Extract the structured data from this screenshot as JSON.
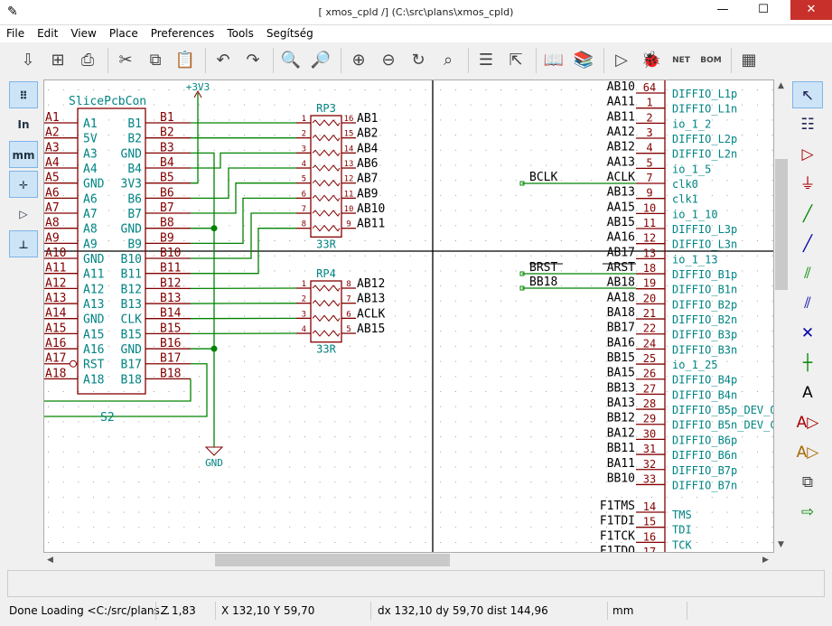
{
  "window": {
    "title": "[ xmos_cpld /] (C:\\src\\plans\\xmos_cpld)",
    "minimize": "—",
    "maximize": "☐",
    "close": "✕"
  },
  "menu": [
    "File",
    "Edit",
    "View",
    "Place",
    "Preferences",
    "Tools",
    "Segítség"
  ],
  "toolbar": [
    "save-icon",
    "page-settings-icon",
    "print-icon",
    "cut-icon",
    "copy-icon",
    "paste-icon",
    "undo-icon",
    "redo-icon",
    "find-icon",
    "find-replace-icon",
    "zoom-in-icon",
    "zoom-out-icon",
    "redraw-icon",
    "zoom-fit-icon",
    "hierarchy-icon",
    "leave-sheet-icon",
    "library-editor-icon",
    "library-browser-icon",
    "annotate-icon",
    "erc-icon",
    "netlist-icon",
    "bom-icon",
    "pcbnew-icon"
  ],
  "toolbar_glyphs": [
    "⇩",
    "⊞",
    "⎙",
    "✂",
    "⧉",
    "📋",
    "↶",
    "↷",
    "🔍",
    "🔎",
    "⊕",
    "⊖",
    "↻",
    "⌕",
    "☰",
    "⇱",
    "📖",
    "📚",
    "▷",
    "🐞",
    "NET",
    "BOM",
    "▦"
  ],
  "left_toolbar": [
    {
      "name": "grid",
      "glyph": "⠿",
      "on": true
    },
    {
      "name": "inch-units",
      "glyph": "In",
      "on": false
    },
    {
      "name": "mm-units",
      "glyph": "mm",
      "on": true
    },
    {
      "name": "cursor-shape",
      "glyph": "✛",
      "on": true
    },
    {
      "name": "hidden-pins",
      "glyph": "▷",
      "on": false
    },
    {
      "name": "wire-angle",
      "glyph": "⊥",
      "on": true
    }
  ],
  "right_toolbar": [
    {
      "name": "select",
      "glyph": "↖",
      "on": true
    },
    {
      "name": "hierarchy-navigator",
      "glyph": "☷"
    },
    {
      "name": "place-component",
      "glyph": "▷"
    },
    {
      "name": "place-power",
      "glyph": "⏚"
    },
    {
      "name": "place-wire",
      "glyph": "╱"
    },
    {
      "name": "place-bus",
      "glyph": "╱"
    },
    {
      "name": "wire-entry",
      "glyph": "⫽"
    },
    {
      "name": "bus-entry",
      "glyph": "⫽"
    },
    {
      "name": "no-connect",
      "glyph": "✕"
    },
    {
      "name": "junction",
      "glyph": "┼"
    },
    {
      "name": "net-label",
      "glyph": "A"
    },
    {
      "name": "global-label",
      "glyph": "A▷"
    },
    {
      "name": "hierarchical-label",
      "glyph": "A▷"
    },
    {
      "name": "hierarchical-sheet",
      "glyph": "⧉"
    },
    {
      "name": "import-sheet-pin",
      "glyph": "⇨"
    }
  ],
  "colors": {
    "wire": "#008400",
    "pin": "#840000",
    "value": "#008484",
    "text": "#000000",
    "accent": "#c7302b"
  },
  "schematic": {
    "connector": {
      "ref": "SlicePcbCon",
      "left_nets": [
        "A1",
        "A2",
        "A3",
        "A4",
        "A5",
        "A6",
        "A7",
        "A8",
        "A9",
        "A10",
        "A11",
        "A12",
        "A13",
        "A14",
        "A15",
        "A16",
        "A17",
        "A18"
      ],
      "inner_left": [
        "A1",
        "5V",
        "A3",
        "A4",
        "GND",
        "A6",
        "A7",
        "A8",
        "A9",
        "GND",
        "A11",
        "A12",
        "A13",
        "GND",
        "A15",
        "A16",
        "RST",
        "A18"
      ],
      "inner_right": [
        "B1",
        "B2",
        "GND",
        "B4",
        "3V3",
        "B6",
        "B7",
        "GND",
        "B9",
        "B10",
        "B11",
        "B12",
        "B13",
        "CLK",
        "B15",
        "GND",
        "B17",
        "B18"
      ],
      "right_nets": [
        "B1",
        "B2",
        "B3",
        "B4",
        "B5",
        "B6",
        "B7",
        "B8",
        "B9",
        "B10",
        "B11",
        "B12",
        "B13",
        "B14",
        "B15",
        "B16",
        "B17",
        "B18"
      ]
    },
    "power_3v3": "+3V3",
    "power_gnd": "GND",
    "net_s2": "S2",
    "rp3": {
      "ref": "RP3",
      "value": "33R",
      "left_pins": [
        "1",
        "2",
        "3",
        "4",
        "5",
        "6",
        "7",
        "8"
      ],
      "right_pins": [
        "16",
        "15",
        "14",
        "13",
        "12",
        "11",
        "10",
        "9"
      ],
      "nets": [
        "AB1",
        "AB2",
        "AB4",
        "AB6",
        "AB7",
        "AB9",
        "AB10",
        "AB11"
      ]
    },
    "rp4": {
      "ref": "RP4",
      "value": "33R",
      "left_pins": [
        "1",
        "2",
        "3",
        "4"
      ],
      "right_pins": [
        "8",
        "7",
        "6",
        "5"
      ],
      "nets": [
        "AB12",
        "AB13",
        "ACLK",
        "AB15"
      ]
    },
    "cpld": {
      "nets": [
        "AB10",
        "AA11",
        "AB11",
        "AA12",
        "AB12",
        "AA13",
        "ACLK",
        "AB13",
        "AA15",
        "AB15",
        "AA16",
        "AB17",
        "ARST",
        "AB18",
        "AA18",
        "BA18",
        "BB17",
        "BA16",
        "BB15",
        "BA15",
        "BB13",
        "BA13",
        "BB12",
        "BA12",
        "BB11",
        "BA11",
        "BB10"
      ],
      "pins": [
        "64",
        "1",
        "2",
        "3",
        "4",
        "5",
        "7",
        "9",
        "10",
        "11",
        "12",
        "13",
        "18",
        "19",
        "20",
        "21",
        "22",
        "24",
        "25",
        "26",
        "27",
        "28",
        "29",
        "30",
        "31",
        "32",
        "33"
      ],
      "names": [
        "DIFFIO_L1p",
        "DIFFIO_L1n",
        "io_1_2",
        "DIFFIO_L2p",
        "DIFFIO_L2n",
        "io_1_5",
        "clk0",
        "clk1",
        "io_1_10",
        "DIFFIO_L3p",
        "DIFFIO_L3n",
        "io_1_13",
        "DIFFIO_B1p",
        "DIFFIO_B1n",
        "DIFFIO_B2p",
        "DIFFIO_B2n",
        "DIFFIO_B3p",
        "DIFFIO_B3n",
        "io_1_25",
        "DIFFIO_B4p",
        "DIFFIO_B4n",
        "DIFFIO_B5p_DEV_O",
        "DIFFIO_B5n_DEV_C",
        "DIFFIO_B6p",
        "DIFFIO_B6n",
        "DIFFIO_B7p",
        "DIFFIO_B7n"
      ],
      "jtag_nets": [
        "F1TMS",
        "F1TDI",
        "F1TCK",
        "F1TDO"
      ],
      "jtag_pins": [
        "14",
        "15",
        "16",
        "17"
      ],
      "jtag_names": [
        "TMS",
        "TDI",
        "TCK",
        "TDO"
      ]
    },
    "labels": {
      "bclk": "BCLK",
      "brst": "BRST",
      "bb18": "BB18"
    }
  },
  "status": {
    "message": "Done Loading <C:/src/plans...",
    "zoom": "Z 1,83",
    "xy": "X 132,10  Y 59,70",
    "delta": "dx 132,10  dy 59,70  dist 144,96",
    "units": "mm"
  }
}
